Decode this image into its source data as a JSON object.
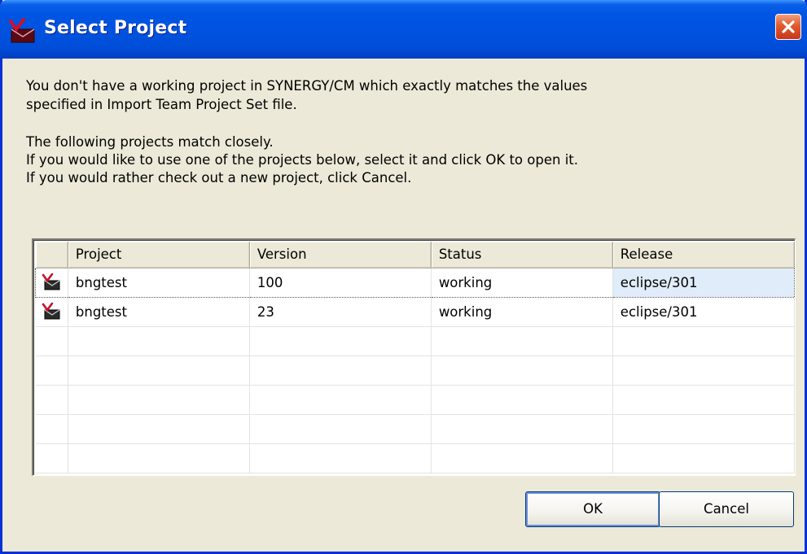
{
  "window": {
    "title": "Select Project",
    "title_icon": "synergy-project-icon",
    "close_icon": "close-icon"
  },
  "message": {
    "line1": "You don't have a working project in SYNERGY/CM which exactly matches the values",
    "line2": "specified in Import Team Project Set file.",
    "line3": "The following projects match closely.",
    "line4": "If you would like to use one of the projects below, select it and click OK to open it.",
    "line5": "If you would rather check out a new project, click Cancel."
  },
  "table": {
    "columns": [
      "",
      "Project",
      "Version",
      "Status",
      "Release"
    ],
    "rows": [
      {
        "icon": "synergy-project-icon",
        "project": "bngtest",
        "version": "100",
        "status": "working",
        "release": "eclipse/301",
        "selected": true
      },
      {
        "icon": "synergy-project-icon",
        "project": "bngtest",
        "version": "23",
        "status": "working",
        "release": "eclipse/301",
        "selected": false
      }
    ]
  },
  "buttons": {
    "ok": "OK",
    "cancel": "Cancel"
  }
}
